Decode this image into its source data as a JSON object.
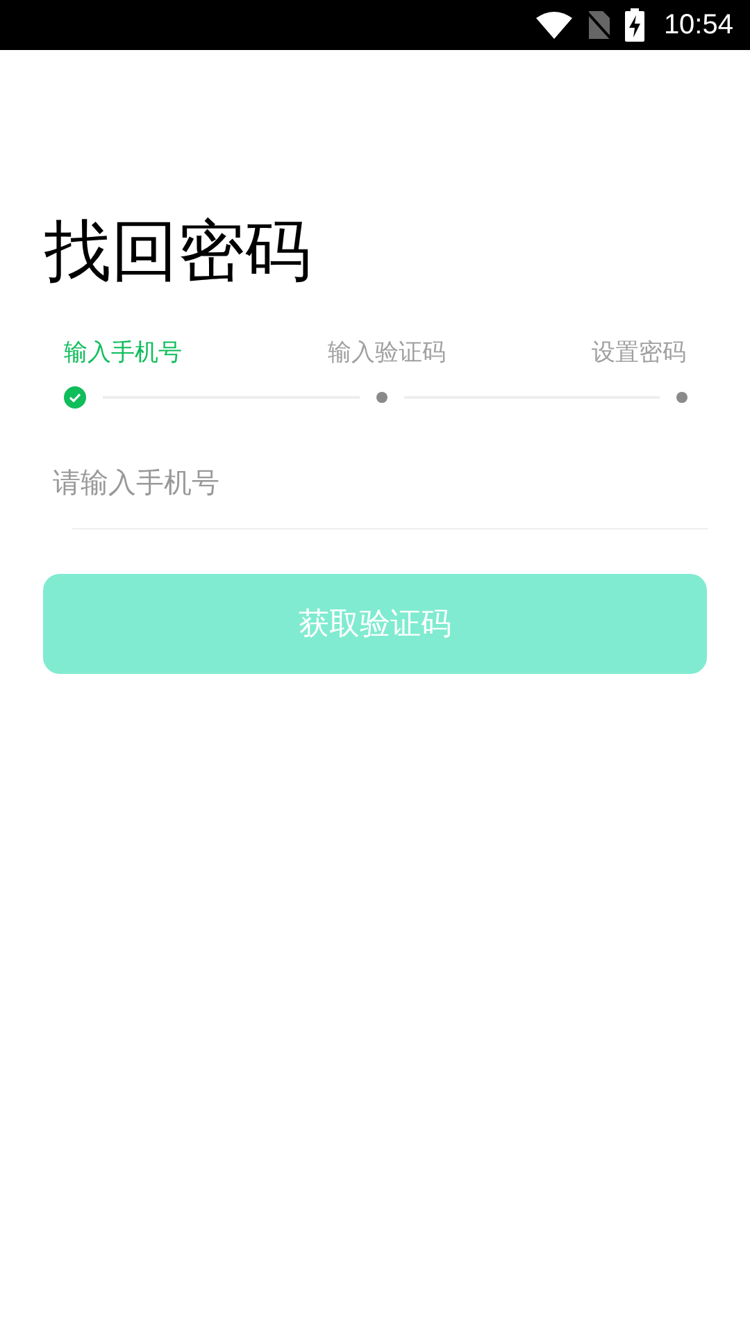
{
  "status_bar": {
    "time": "10:54"
  },
  "title": "找回密码",
  "steps": [
    {
      "label": "输入手机号",
      "selected": true
    },
    {
      "label": "输入验证码",
      "selected": false
    },
    {
      "label": "设置密码",
      "selected": false
    }
  ],
  "phone_field": {
    "placeholder": "请输入手机号"
  },
  "submit_button": {
    "label": "获取验证码",
    "disabled": true
  }
}
